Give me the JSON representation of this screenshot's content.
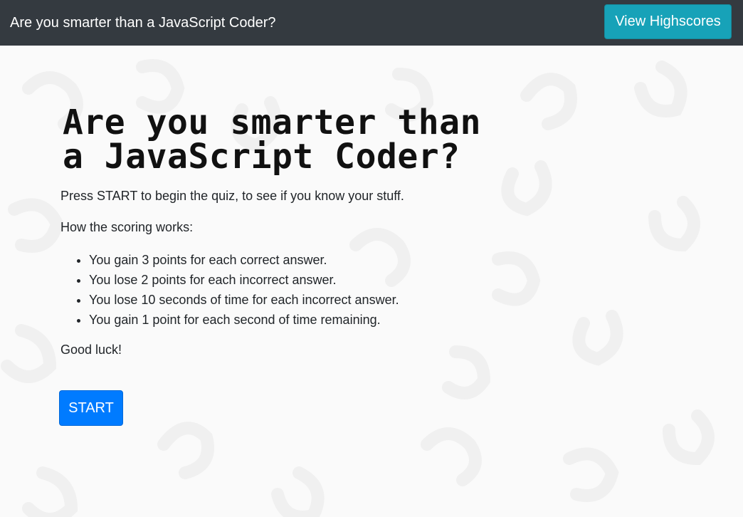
{
  "navbar": {
    "brand": "Are you smarter than a JavaScript Coder?",
    "highscores_label": "View Highscores"
  },
  "main": {
    "title_line1": "Are you smarter than",
    "title_line2": "a JavaScript Coder?",
    "intro": "Press START to begin the quiz, to see if you know your stuff.",
    "scoring_heading": "How the scoring works:",
    "rules": [
      "You gain 3 points for each correct answer.",
      "You lose 2 points for each incorrect answer.",
      "You lose 10 seconds of time for each incorrect answer.",
      "You gain 1 point for each second of time remaining."
    ],
    "closing": "Good luck!",
    "start_label": "START"
  },
  "colors": {
    "navbar_bg": "#343a40",
    "highscores_button": "#17a2b8",
    "start_button": "#007bff",
    "page_bg": "#fafafa"
  }
}
